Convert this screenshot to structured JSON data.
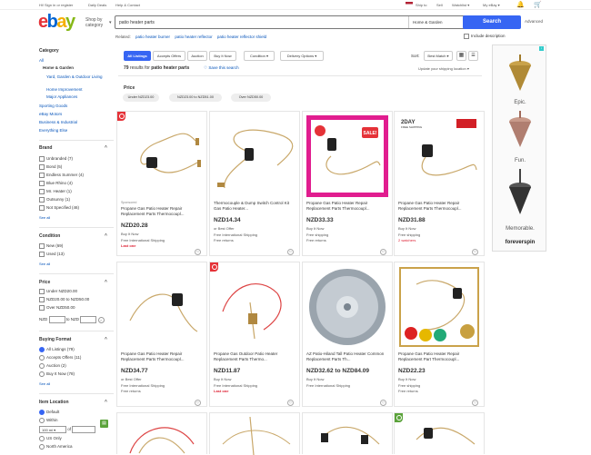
{
  "topbar": {
    "greeting": "Hi! Sign in or register",
    "daily_deals": "Daily Deals",
    "help": "Help & Contact",
    "ship_to": "Ship to",
    "sell": "Sell",
    "watchlist": "Watchlist ▾",
    "my_ebay": "My eBay ▾"
  },
  "header": {
    "shop_by": "Shop by category",
    "search_value": "patio heater parts",
    "category": "Home & Garden",
    "search_button": "Search",
    "advanced": "Advanced",
    "related_label": "Related:",
    "related": [
      "patio heater burner",
      "patio heater reflector",
      "patio heater reflector shield"
    ],
    "include_description": "Include description"
  },
  "sidebar": {
    "category_title": "Category",
    "all": "All",
    "home_garden": "Home & Garden",
    "sub1": "Yard, Garden & Outdoor Living",
    "sub2": "Home Improvement",
    "sub3": "Major Appliances",
    "cat2": "Sporting Goods",
    "cat3": "eBay Motors",
    "cat4": "Business & Industrial",
    "cat5": "Everything Else",
    "brand_title": "Brand",
    "brands": [
      "Unbranded (7)",
      "Bond (5)",
      "Endless Summer (4)",
      "Blue Rhino (4)",
      "Mr. Heater (1)",
      "Outsunny (1)",
      "Not Specified (46)"
    ],
    "see_all": "See all",
    "condition_title": "Condition",
    "conditions": [
      "New (69)",
      "Used (13)"
    ],
    "price_title": "Price",
    "prices": [
      "Under NZD20.00",
      "NZD20.00 to NZD50.00",
      "Over NZD50.00"
    ],
    "nzd_label": "NZD",
    "to_label": "to NZD",
    "buying_title": "Buying Format",
    "formats": [
      "All Listings (79)",
      "Accepts Offers (11)",
      "Auction (2)",
      "Buy It Now (78)"
    ],
    "location_title": "Item Location",
    "loc_default": "Default",
    "loc_within": "Within",
    "loc_distance": "100 mi",
    "loc_of": "of",
    "loc_us": "US Only",
    "loc_na": "North America"
  },
  "results": {
    "tabs": [
      "All Listings",
      "Accepts Offers",
      "Auction",
      "Buy It Now"
    ],
    "condition_btn": "Condition ▾",
    "delivery_btn": "Delivery Options ▾",
    "sort_label": "Sort:",
    "sort_value": "Best Match ▾",
    "count": "79",
    "count_suffix": "results for",
    "query": "patio heater parts",
    "save_search": "Save this search",
    "shipping_loc": "Update your shipping location ▾",
    "price_label": "Price",
    "price_chips": [
      "Under NZD23.00",
      "NZD23.00 to NZD51.00",
      "Over NZD50.00"
    ]
  },
  "cards": [
    {
      "sponsored": "Sponsored",
      "title": "Propane Gas Patio Heater Repair Replacement Parts Thermocoupl...",
      "price": "NZD20.28",
      "meta": [
        "Buy It Now",
        "Free International Shipping"
      ],
      "red": "Last one"
    },
    {
      "title": "Thermocouple & Dump Switch Control Kit Gas Patio Heater...",
      "price": "NZD14.34",
      "meta": [
        "or Best Offer",
        "Free International Shipping",
        "Free returns"
      ]
    },
    {
      "title": "Propane Gas Patio Heater Repair Replacement Parts Thermocoupl...",
      "price": "NZD33.33",
      "meta": [
        "Buy It Now",
        "Free shipping",
        "Free returns"
      ]
    },
    {
      "title": "Propane Gas Patio Heater Repair Replacement Parts Thermocoupl...",
      "price": "NZD31.88",
      "meta": [
        "Buy It Now",
        "Free shipping"
      ],
      "red": "2 watchers"
    },
    {
      "title": "Propane Gas Patio Heater Repair Replacement Parts Thermocoupl...",
      "price": "NZD34.77",
      "meta": [
        "or Best Offer",
        "Free International Shipping",
        "Free returns"
      ]
    },
    {
      "title": "Propane Gas Outdoor Patio Heater Replacement Parts Thermo...",
      "price": "NZD11.87",
      "meta": [
        "Buy It Now",
        "Free International Shipping"
      ],
      "red": "Last one"
    },
    {
      "title": "AZ Patio-Hiland Tall Patio Heater Common Replacement Parts Th...",
      "price": "NZD32.62 to NZD84.09",
      "meta": [
        "Buy It Now",
        "Free International Shipping"
      ]
    },
    {
      "title": "Propane Gas Patio Heater Repair Replacement Part Thermocoupl...",
      "price": "NZD22.23",
      "meta": [
        "Buy It Now",
        "Free shipping",
        "Free returns"
      ]
    }
  ],
  "ad": {
    "word1": "Epic.",
    "word2": "Fun.",
    "word3": "Memorable.",
    "brand": "foreverspin"
  },
  "promo": {
    "tag1": "2DAY",
    "tag2": "FREE SHIPPING",
    "sale": "SALE!"
  },
  "colors": {
    "accent": "#3665f3",
    "link": "#0654ba",
    "red": "#dd1e31"
  }
}
